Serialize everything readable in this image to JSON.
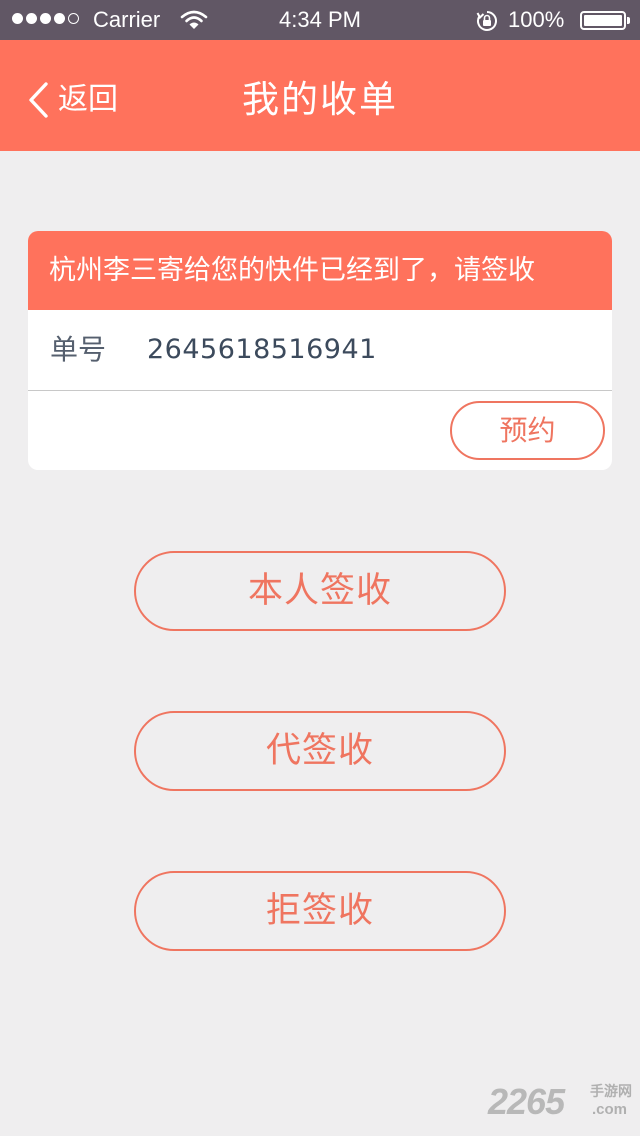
{
  "status_bar": {
    "carrier": "Carrier",
    "time": "4:34 PM",
    "battery": "100%",
    "signal_bars_filled": 4,
    "signal_bars_total": 5,
    "icons": [
      "wifi-icon",
      "rotation-lock-icon",
      "battery-icon"
    ]
  },
  "nav": {
    "back_label": "返回",
    "title": "我的收单",
    "back_icon": "chevron-left-icon"
  },
  "card": {
    "header": "杭州李三寄给您的快件已经到了，请签收",
    "order_label": "单号",
    "order_number": "2645618516941",
    "appointment_label": "预约"
  },
  "actions": {
    "sign_self": "本人签收",
    "sign_proxy": "代签收",
    "refuse": "拒签收"
  },
  "watermark": {
    "digits": "2265",
    "chinese": "手游网",
    "domain": ".com"
  },
  "colors": {
    "accent": "#ff725c",
    "button_outline": "#ef7560",
    "status_bar": "#615765",
    "background": "#efeeef"
  }
}
